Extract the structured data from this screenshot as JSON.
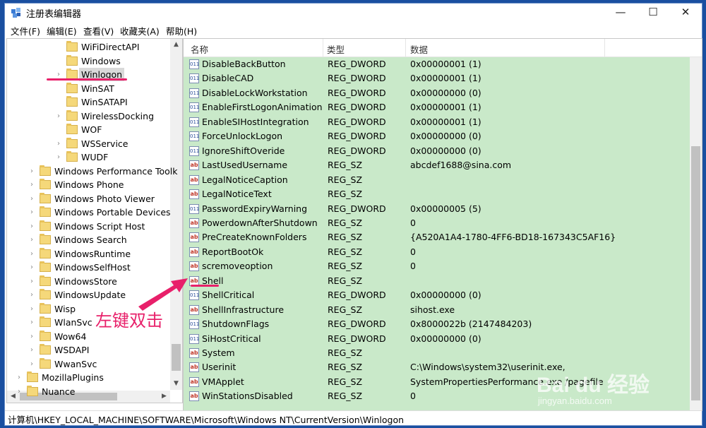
{
  "window": {
    "title": "注册表编辑器",
    "minimize": "—",
    "maximize": "☐",
    "close": "✕"
  },
  "menu": [
    "文件(F)",
    "编辑(E)",
    "查看(V)",
    "收藏夹(A)",
    "帮助(H)"
  ],
  "tree": {
    "items": [
      {
        "label": "WiFiDirectAPI",
        "level": 2,
        "expandable": false
      },
      {
        "label": "Windows",
        "level": 2,
        "expandable": false
      },
      {
        "label": "Winlogon",
        "level": 2,
        "expandable": true,
        "selected": true
      },
      {
        "label": "WinSAT",
        "level": 2,
        "expandable": false
      },
      {
        "label": "WinSATAPI",
        "level": 2,
        "expandable": false
      },
      {
        "label": "WirelessDocking",
        "level": 2,
        "expandable": true
      },
      {
        "label": "WOF",
        "level": 2,
        "expandable": false
      },
      {
        "label": "WSService",
        "level": 2,
        "expandable": true
      },
      {
        "label": "WUDF",
        "level": 2,
        "expandable": true
      },
      {
        "label": "Windows Performance Toolk",
        "level": 1,
        "expandable": true
      },
      {
        "label": "Windows Phone",
        "level": 1,
        "expandable": true
      },
      {
        "label": "Windows Photo Viewer",
        "level": 1,
        "expandable": true
      },
      {
        "label": "Windows Portable Devices",
        "level": 1,
        "expandable": true
      },
      {
        "label": "Windows Script Host",
        "level": 1,
        "expandable": true
      },
      {
        "label": "Windows Search",
        "level": 1,
        "expandable": true
      },
      {
        "label": "WindowsRuntime",
        "level": 1,
        "expandable": true
      },
      {
        "label": "WindowsSelfHost",
        "level": 1,
        "expandable": true
      },
      {
        "label": "WindowsStore",
        "level": 1,
        "expandable": true
      },
      {
        "label": "WindowsUpdate",
        "level": 1,
        "expandable": true
      },
      {
        "label": "Wisp",
        "level": 1,
        "expandable": true
      },
      {
        "label": "WlanSvc",
        "level": 1,
        "expandable": true
      },
      {
        "label": "Wow64",
        "level": 1,
        "expandable": true
      },
      {
        "label": "WSDAPI",
        "level": 1,
        "expandable": true
      },
      {
        "label": "WwanSvc",
        "level": 1,
        "expandable": true
      },
      {
        "label": "MozillaPlugins",
        "level": 0,
        "expandable": true
      },
      {
        "label": "Nuance",
        "level": 0,
        "expandable": true
      }
    ]
  },
  "list": {
    "headers": {
      "name": "名称",
      "type": "类型",
      "data": "数据"
    },
    "rows": [
      {
        "icon": "dword",
        "name": "DisableBackButton",
        "type": "REG_DWORD",
        "data": "0x00000001 (1)"
      },
      {
        "icon": "dword",
        "name": "DisableCAD",
        "type": "REG_DWORD",
        "data": "0x00000001 (1)"
      },
      {
        "icon": "dword",
        "name": "DisableLockWorkstation",
        "type": "REG_DWORD",
        "data": "0x00000000 (0)"
      },
      {
        "icon": "dword",
        "name": "EnableFirstLogonAnimation",
        "type": "REG_DWORD",
        "data": "0x00000001 (1)"
      },
      {
        "icon": "dword",
        "name": "EnableSIHostIntegration",
        "type": "REG_DWORD",
        "data": "0x00000001 (1)"
      },
      {
        "icon": "dword",
        "name": "ForceUnlockLogon",
        "type": "REG_DWORD",
        "data": "0x00000000 (0)"
      },
      {
        "icon": "dword",
        "name": "IgnoreShiftOveride",
        "type": "REG_DWORD",
        "data": "0x00000000 (0)"
      },
      {
        "icon": "sz",
        "name": "LastUsedUsername",
        "type": "REG_SZ",
        "data": "abcdef1688@sina.com"
      },
      {
        "icon": "sz",
        "name": "LegalNoticeCaption",
        "type": "REG_SZ",
        "data": ""
      },
      {
        "icon": "sz",
        "name": "LegalNoticeText",
        "type": "REG_SZ",
        "data": ""
      },
      {
        "icon": "dword",
        "name": "PasswordExpiryWarning",
        "type": "REG_DWORD",
        "data": "0x00000005 (5)"
      },
      {
        "icon": "sz",
        "name": "PowerdownAfterShutdown",
        "type": "REG_SZ",
        "data": "0"
      },
      {
        "icon": "sz",
        "name": "PreCreateKnownFolders",
        "type": "REG_SZ",
        "data": "{A520A1A4-1780-4FF6-BD18-167343C5AF16}"
      },
      {
        "icon": "sz",
        "name": "ReportBootOk",
        "type": "REG_SZ",
        "data": "0"
      },
      {
        "icon": "sz",
        "name": "scremoveoption",
        "type": "REG_SZ",
        "data": "0"
      },
      {
        "icon": "sz",
        "name": "Shell",
        "type": "REG_SZ",
        "data": ""
      },
      {
        "icon": "dword",
        "name": "ShellCritical",
        "type": "REG_DWORD",
        "data": "0x00000000 (0)"
      },
      {
        "icon": "sz",
        "name": "ShellInfrastructure",
        "type": "REG_SZ",
        "data": "sihost.exe"
      },
      {
        "icon": "dword",
        "name": "ShutdownFlags",
        "type": "REG_DWORD",
        "data": "0x8000022b (2147484203)"
      },
      {
        "icon": "dword",
        "name": "SiHostCritical",
        "type": "REG_DWORD",
        "data": "0x00000000 (0)"
      },
      {
        "icon": "sz",
        "name": "System",
        "type": "REG_SZ",
        "data": ""
      },
      {
        "icon": "sz",
        "name": "Userinit",
        "type": "REG_SZ",
        "data": "C:\\Windows\\system32\\userinit.exe,"
      },
      {
        "icon": "sz",
        "name": "VMApplet",
        "type": "REG_SZ",
        "data": "SystemPropertiesPerformance.exe /pagefile"
      },
      {
        "icon": "sz",
        "name": "WinStationsDisabled",
        "type": "REG_SZ",
        "data": "0"
      }
    ]
  },
  "status": {
    "path": "计算机\\HKEY_LOCAL_MACHINE\\SOFTWARE\\Microsoft\\Windows NT\\CurrentVersion\\Winlogon"
  },
  "annotation": {
    "text": "左键双击",
    "color": "#e8206a"
  },
  "watermark": {
    "brand": "Bai du 经验",
    "url": "jingyan.baidu.com"
  },
  "colors": {
    "list_bg": "#c9e9c9",
    "accent": "#e8206a"
  }
}
